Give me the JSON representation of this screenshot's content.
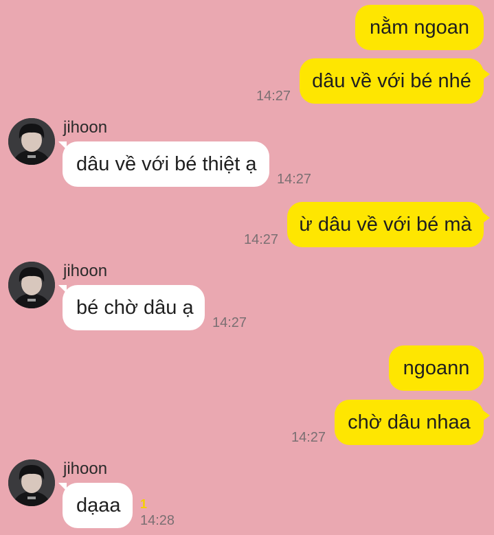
{
  "messages": [
    {
      "text": "nằm ngoan"
    },
    {
      "text": "dâu về với bé nhé",
      "time": "14:27"
    },
    {
      "sender": "jihoon",
      "text": "dâu về với bé thiệt ạ",
      "time": "14:27"
    },
    {
      "text": "ừ dâu về với bé mà",
      "time": "14:27"
    },
    {
      "sender": "jihoon",
      "text": "bé chờ dâu ạ",
      "time": "14:27"
    },
    {
      "text": "ngoann"
    },
    {
      "text": "chờ dâu nhaa",
      "time": "14:27"
    },
    {
      "sender": "jihoon",
      "text": "dạaa",
      "time": "14:28",
      "unread": "1"
    }
  ],
  "colors": {
    "background": "#eaa8b1",
    "outgoing_bubble": "#fee601",
    "incoming_bubble": "#ffffff",
    "timestamp": "#7a6f72",
    "unread_count": "#f5d000"
  },
  "icons": {
    "avatar": "profile-photo"
  }
}
